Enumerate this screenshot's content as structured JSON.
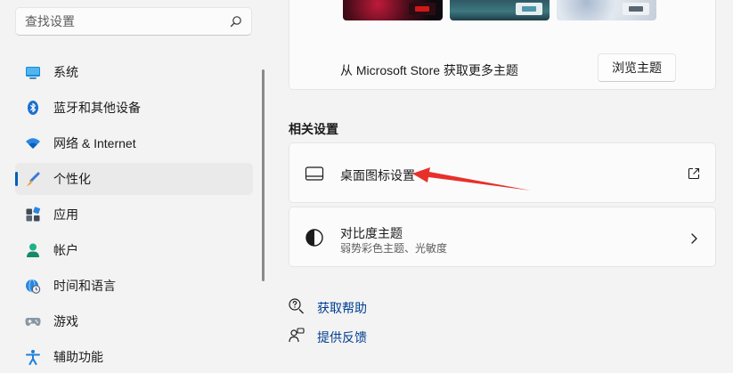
{
  "search": {
    "placeholder": "查找设置",
    "icon": "search-icon"
  },
  "sidebar": {
    "items": [
      {
        "label": "系统",
        "icon": "monitor-icon",
        "active": false
      },
      {
        "label": "蓝牙和其他设备",
        "icon": "bluetooth-icon",
        "active": false
      },
      {
        "label": "网络 & Internet",
        "icon": "wifi-icon",
        "active": false
      },
      {
        "label": "个性化",
        "icon": "brush-icon",
        "active": true
      },
      {
        "label": "应用",
        "icon": "apps-icon",
        "active": false
      },
      {
        "label": "帐户",
        "icon": "account-icon",
        "active": false
      },
      {
        "label": "时间和语言",
        "icon": "globe-clock-icon",
        "active": false
      },
      {
        "label": "游戏",
        "icon": "gamepad-icon",
        "active": false
      },
      {
        "label": "辅助功能",
        "icon": "accessibility-icon",
        "active": false
      }
    ]
  },
  "themes": {
    "store_text": "从 Microsoft Store 获取更多主题",
    "browse_button": "浏览主题"
  },
  "related": {
    "title": "相关设置",
    "desktop_icons": {
      "title": "桌面图标设置",
      "icon": "desktop-icon",
      "trailing_icon": "open-external-icon"
    },
    "contrast": {
      "title": "对比度主题",
      "subtitle": "弱势彩色主题、光敏度",
      "icon": "contrast-icon",
      "trailing_icon": "chevron-right-icon"
    }
  },
  "help": {
    "get_help": "获取帮助",
    "feedback": "提供反馈"
  },
  "colors": {
    "accent": "#005fb8",
    "link": "#003e92",
    "annotation_arrow": "#e8302a"
  }
}
